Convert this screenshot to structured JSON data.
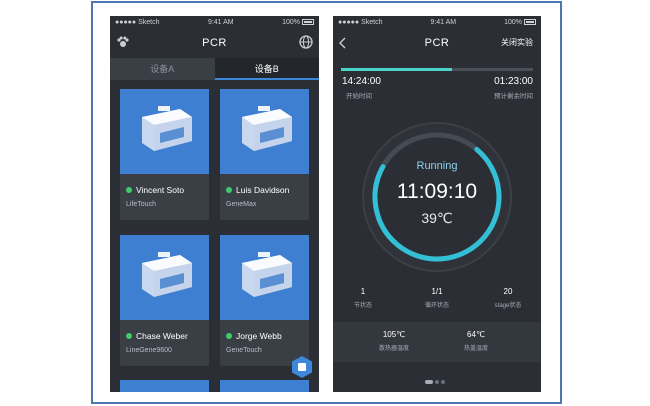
{
  "phone_a": {
    "status": {
      "carrier": "●●●●● Sketch",
      "time": "9:41 AM",
      "battery": "100%"
    },
    "title": "PCR",
    "tabs": [
      {
        "label": "设备A",
        "active": false
      },
      {
        "label": "设备B",
        "active": true
      }
    ],
    "devices": [
      {
        "name": "Vincent Soto",
        "model": "LifeTouch",
        "online": true
      },
      {
        "name": "Luis Davidson",
        "model": "GeneMax",
        "online": true
      },
      {
        "name": "Chase Weber",
        "model": "LineGene9600",
        "online": true
      },
      {
        "name": "Jorge Webb",
        "model": "GeneTouch",
        "online": true
      }
    ],
    "icons": {
      "left": "paw-icon",
      "right": "globe-icon",
      "fab": "stop-icon"
    },
    "colors": {
      "accent": "#3d88d8",
      "card": "#3f7fd1",
      "online": "#3dcc6a",
      "background": "#2b2f35"
    }
  },
  "phone_b": {
    "status": {
      "carrier": "●●●●● Sketch",
      "time": "9:41 AM",
      "battery": "100%"
    },
    "title": "PCR",
    "close_label": "关闭实验",
    "progress": 0.58,
    "start_time": "14:24:00",
    "start_label": "开始时间",
    "remaining_time": "01:23:00",
    "remaining_label": "预计剩余时间",
    "dial": {
      "status": "Running",
      "time": "11:09:10",
      "temperature": "39℃",
      "progress": 0.72
    },
    "stats": [
      {
        "value": "1",
        "label": "节状态"
      },
      {
        "value": "1/1",
        "label": "循环状态"
      },
      {
        "value": "20",
        "label": "stage状态"
      }
    ],
    "temps": [
      {
        "value": "105℃",
        "label": "散热器温度"
      },
      {
        "value": "64℃",
        "label": "热盖温度"
      }
    ],
    "pager": {
      "count": 3,
      "active": 0
    },
    "colors": {
      "ring": "#33c0d6",
      "progress": "#4ad3c8"
    }
  }
}
